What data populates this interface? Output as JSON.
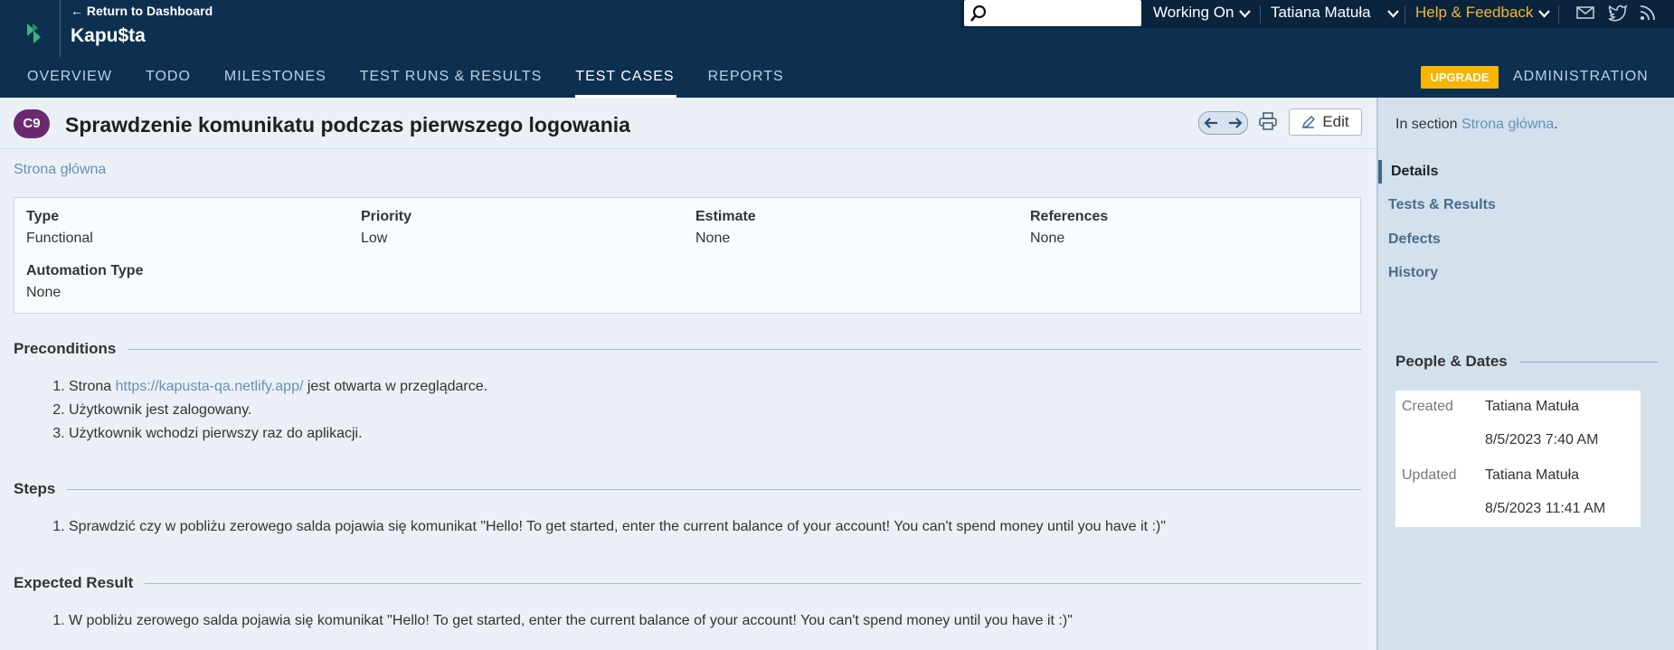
{
  "header": {
    "return_link": "← Return to Dashboard",
    "project_name": "Kapu$ta",
    "search_placeholder": "",
    "working_on": "Working On",
    "user": "Tatiana Matuła",
    "help": "Help & Feedback"
  },
  "nav": {
    "tabs": [
      {
        "label": "OVERVIEW"
      },
      {
        "label": "TODO"
      },
      {
        "label": "MILESTONES"
      },
      {
        "label": "TEST RUNS & RESULTS"
      },
      {
        "label": "TEST CASES",
        "active": true
      },
      {
        "label": "REPORTS"
      }
    ],
    "upgrade": "UPGRADE",
    "administration": "ADMINISTRATION"
  },
  "case": {
    "id": "C9",
    "title": "Sprawdzenie komunikatu podczas pierwszego logowania",
    "edit": "Edit",
    "section": "Strona główna"
  },
  "fields": {
    "type_label": "Type",
    "type_value": "Functional",
    "priority_label": "Priority",
    "priority_value": "Low",
    "estimate_label": "Estimate",
    "estimate_value": "None",
    "references_label": "References",
    "references_value": "None",
    "automation_label": "Automation Type",
    "automation_value": "None"
  },
  "preconditions": {
    "heading": "Preconditions",
    "item1_prefix": "Strona ",
    "item1_link": "https://kapusta-qa.netlify.app/",
    "item1_suffix": " jest otwarta w przeglądarce.",
    "item2": "Użytkownik jest zalogowany.",
    "item3": "Użytkownik wchodzi pierwszy raz do aplikacji."
  },
  "steps": {
    "heading": "Steps",
    "item1": "Sprawdzić czy w pobliżu zerowego salda pojawia się komunikat \"Hello! To get started, enter the current balance of your account! You can't spend money until you have it :)\""
  },
  "expected": {
    "heading": "Expected Result",
    "item1": "W pobliżu zerowego salda pojawia się komunikat \"Hello! To get started, enter the current balance of your account! You can't spend money until you have it :)\""
  },
  "sidebar": {
    "in_section_prefix": "In section ",
    "in_section_link": "Strona główna",
    "in_section_suffix": ".",
    "items": [
      {
        "label": "Details"
      },
      {
        "label": "Tests & Results"
      },
      {
        "label": "Defects"
      },
      {
        "label": "History"
      }
    ],
    "people_heading": "People & Dates",
    "created_label": "Created",
    "created_by": "Tatiana Matuła",
    "created_date": "8/5/2023 7:40 AM",
    "updated_label": "Updated",
    "updated_by": "Tatiana Matuła",
    "updated_date": "8/5/2023 11:41 AM"
  },
  "colors": {
    "header_bg": "#0e3050",
    "accent_link": "#6791b4",
    "badge": "#6b2a70",
    "upgrade": "#f7b500",
    "help": "#f2b636"
  },
  "icons": [
    "logo-icon",
    "search-icon",
    "chevron-down-icon",
    "mail-icon",
    "twitter-icon",
    "rss-icon",
    "arrow-left-icon",
    "arrow-right-icon",
    "print-icon",
    "edit-icon"
  ]
}
